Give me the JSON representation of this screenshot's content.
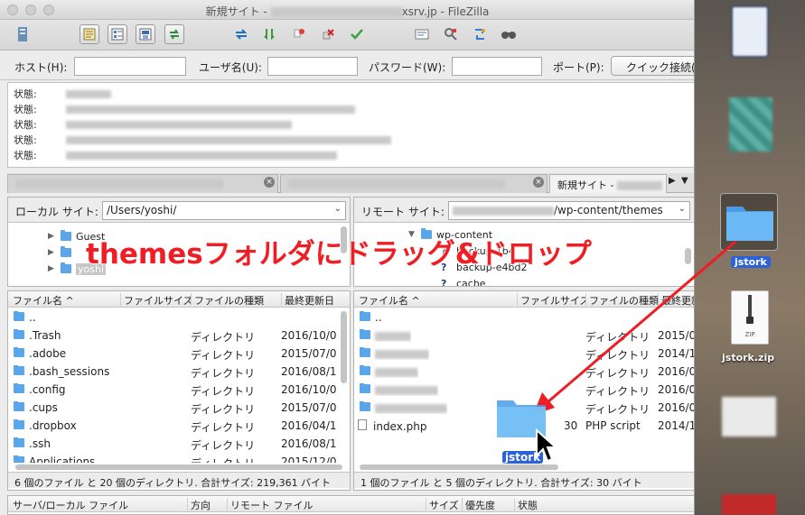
{
  "colors": {
    "accent_red": "#ef1d24",
    "folder_blue": "#5aa6ea",
    "selection_blue": "#2b62d8"
  },
  "window": {
    "title_prefix": "新規サイト - ",
    "title_suffix": "xsrv.jp - FileZilla"
  },
  "toolbar": {
    "icons": [
      "site-manager-icon",
      "message-log-icon",
      "directory-tree-icon",
      "remote-tree-icon",
      "transfer-queue-icon",
      "refresh-icon",
      "process-queue-icon",
      "cancel-icon",
      "disconnect-icon",
      "reconnect-icon",
      "filter-icon",
      "compare-icon",
      "sync-browse-icon",
      "search-icon"
    ]
  },
  "quickconnect": {
    "host_label": "ホスト(H):",
    "user_label": "ユーザ名(U):",
    "pass_label": "パスワード(W):",
    "port_label": "ポート(P):",
    "button_label": "クイック接続(Q)"
  },
  "log": {
    "rows": [
      {
        "label": "状態:"
      },
      {
        "label": "状態:"
      },
      {
        "label": "状態:"
      },
      {
        "label": "状態:"
      },
      {
        "label": "状態:"
      }
    ]
  },
  "tabs": [
    {
      "label": ""
    },
    {
      "label": ""
    },
    {
      "label": "新規サイト - "
    }
  ],
  "local": {
    "site_label": "ローカル サイト:",
    "path": "/Users/yoshi/",
    "tree": [
      {
        "name": "Guest"
      },
      {
        "name": ""
      },
      {
        "name": "yoshi"
      }
    ],
    "headers": {
      "name": "ファイル名",
      "size": "ファイルサイズ",
      "type": "ファイルの種類",
      "modified": "最終更新日"
    },
    "files": [
      {
        "name": "..",
        "type": "",
        "modified": ""
      },
      {
        "name": ".Trash",
        "type": "ディレクトリ",
        "modified": "2016/10/0"
      },
      {
        "name": ".adobe",
        "type": "ディレクトリ",
        "modified": "2015/07/0"
      },
      {
        "name": ".bash_sessions",
        "type": "ディレクトリ",
        "modified": "2016/08/1"
      },
      {
        "name": ".config",
        "type": "ディレクトリ",
        "modified": "2016/10/0"
      },
      {
        "name": ".cups",
        "type": "ディレクトリ",
        "modified": "2015/07/0"
      },
      {
        "name": ".dropbox",
        "type": "ディレクトリ",
        "modified": "2016/04/1"
      },
      {
        "name": ".ssh",
        "type": "ディレクトリ",
        "modified": "2016/08/1"
      },
      {
        "name": "Applications",
        "type": "ディレクトリ",
        "modified": "2015/12/0"
      }
    ],
    "status": "6 個のファイル と 20 個のディレクトリ. 合計サイズ: 219,361 バイト"
  },
  "remote": {
    "site_label": "リモート サイト:",
    "path": "/wp-content/themes",
    "tree": [
      {
        "name": "wp-content"
      },
      {
        "name": "backup-1b4"
      },
      {
        "name": "backup-e4bd2"
      },
      {
        "name": "cache"
      }
    ],
    "headers": {
      "name": "ファイル名",
      "size": "ファイルサイズ",
      "type": "ファイルの種類",
      "modified": "最終更新日"
    },
    "files": [
      {
        "name": "..",
        "size": "",
        "type": "",
        "modified": ""
      },
      {
        "name": "",
        "size": "",
        "type": "ディレクトリ",
        "modified": "2015/0"
      },
      {
        "name": "",
        "size": "",
        "type": "ディレクトリ",
        "modified": "2014/1"
      },
      {
        "name": "",
        "size": "",
        "type": "ディレクトリ",
        "modified": "2016/0"
      },
      {
        "name": "",
        "size": "",
        "type": "ディレクトリ",
        "modified": "2016/0"
      },
      {
        "name": "",
        "size": "",
        "type": "ディレクトリ",
        "modified": "2016/0"
      },
      {
        "name": "index.php",
        "size": "30",
        "type": "PHP script",
        "modified": "2014/1"
      }
    ],
    "status": "1 個のファイル と 5 個のディレクトリ. 合計サイズ: 30 バイト"
  },
  "queue": {
    "headers": {
      "local": "サーバ/ローカル ファイル",
      "direction": "方向",
      "remote": "リモート ファイル",
      "size": "サイズ",
      "priority": "優先度",
      "status": "状態"
    }
  },
  "annotation": {
    "text": "themesフォルダにドラッグ&ドロップ",
    "drag_label": "jstork"
  },
  "desktop": {
    "folder_label": "jstork",
    "zip_label": "jstork.zip",
    "zip_badge": "ZIP"
  }
}
